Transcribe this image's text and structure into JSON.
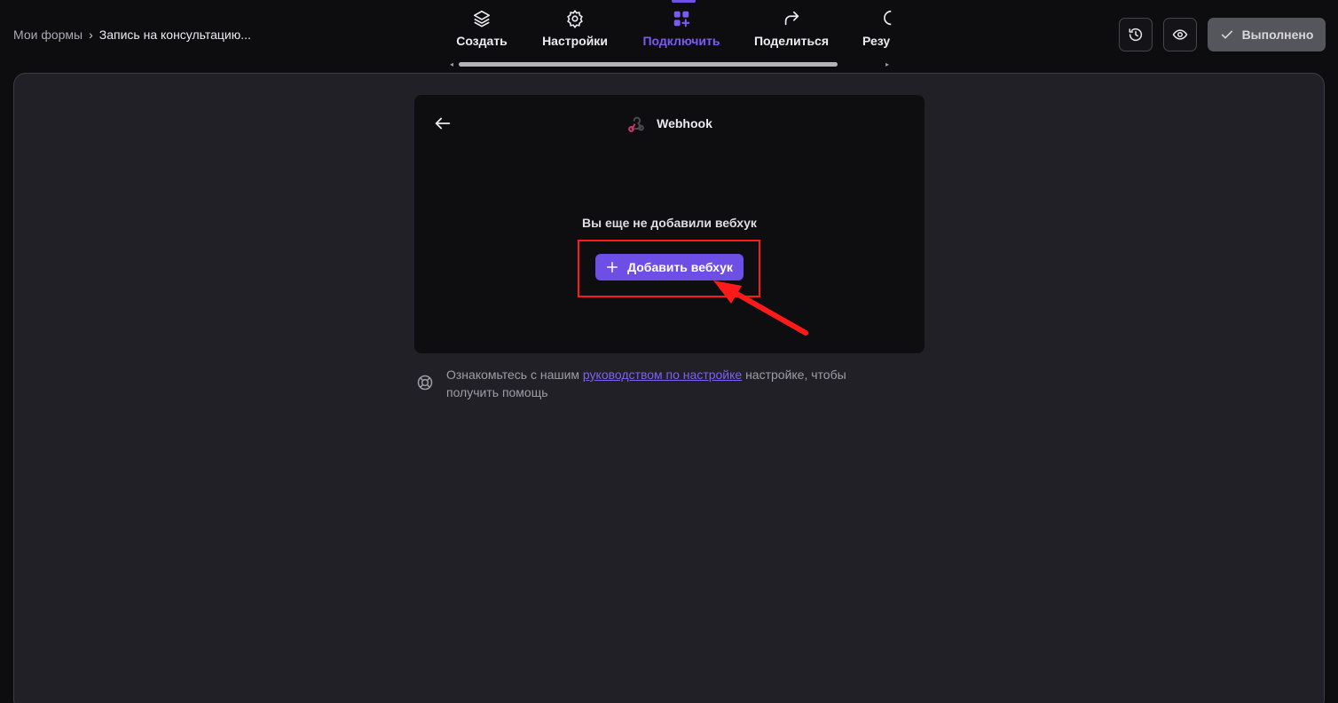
{
  "breadcrumb": {
    "root": "Мои формы",
    "separator": "›",
    "current": "Запись на консультацию..."
  },
  "tabs": [
    {
      "label": "Создать",
      "icon": "layers-icon",
      "active": false
    },
    {
      "label": "Настройки",
      "icon": "gear-icon",
      "active": false
    },
    {
      "label": "Подключить",
      "icon": "apps-add-icon",
      "active": true
    },
    {
      "label": "Поделиться",
      "icon": "share-arrow-icon",
      "active": false
    },
    {
      "label": "Резу",
      "icon": "results-icon",
      "active": false
    }
  ],
  "toolbar": {
    "history_icon": "history-icon",
    "preview_icon": "eye-icon",
    "done_label": "Выполнено"
  },
  "webhook": {
    "title": "Webhook",
    "empty_text": "Вы еще не добавили вебхук",
    "add_label": "Добавить вебхук"
  },
  "help": {
    "prefix": "Ознакомьтесь с нашим ",
    "link": "руководством по настройке",
    "suffix": " настройке, чтобы получить помощь"
  },
  "colors": {
    "accent": "#6d4fe6",
    "background": "#0d0d10",
    "canvas": "#202026",
    "annotation": "#ff1a1a"
  }
}
